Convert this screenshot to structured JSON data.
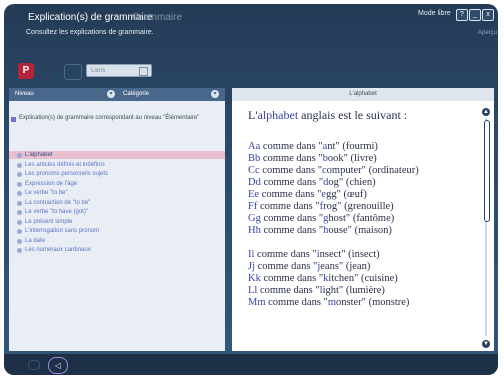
{
  "window": {
    "title": "Explication(s) de grammaire",
    "title_ghost": "Grammaire",
    "subtitle": "Consultez les explications de grammaire.",
    "mode_label": "Mode libre",
    "apercu_label": "Aperçu",
    "controls": [
      "?",
      "_",
      "x"
    ]
  },
  "toolbar": {
    "red_button_label": "P",
    "field_label": "Liens"
  },
  "left_panel": {
    "header": {
      "niveau": "Niveau",
      "categorie": "Catégorie"
    },
    "intro": "Explication(s) de grammaire correspondant au niveau \"Élémentaire\"",
    "items": [
      {
        "label": "L'alphabet",
        "selected": true
      },
      {
        "label": "Les articles définis et indéfinis"
      },
      {
        "label": "Les pronoms personnels sujets"
      },
      {
        "label": "Expression de l'âge"
      },
      {
        "label": "Le verbe \"to be\""
      },
      {
        "label": "La contraction de \"to be\""
      },
      {
        "label": "Le verbe \"to have (got)\""
      },
      {
        "label": "Le présent simple"
      },
      {
        "label": "L'interrogation sans pronom"
      },
      {
        "label": "La date"
      },
      {
        "label": "Les numéraux cardinaux"
      }
    ]
  },
  "right_panel": {
    "header": "L'alphabet",
    "intro_prefix": "L'",
    "intro_word": "alphabet",
    "intro_suffix": " anglais est le suivant :",
    "lines": [
      {
        "label": "Aa",
        "pre": " comme dans \"",
        "hl": "a",
        "rest": "nt\" (fourmi)"
      },
      {
        "label": "Bb",
        "pre": " comme dans \"",
        "hl": "b",
        "rest": "ook\" (livre)"
      },
      {
        "label": "Cc",
        "pre": " comme dans \"",
        "hl": "c",
        "rest": "omputer\" (ordinateur)"
      },
      {
        "label": "Dd",
        "pre": " comme dans \"",
        "hl": "d",
        "rest": "og\" (chien)"
      },
      {
        "label": "Ee",
        "pre": " comme dans \"",
        "hl": "e",
        "rest": "gg\" (œuf)"
      },
      {
        "label": "Ff",
        "pre": " comme dans \"",
        "hl": "f",
        "rest": "rog\" (grenouille)"
      },
      {
        "label": "Gg",
        "pre": " comme dans \"",
        "hl": "g",
        "rest": "host\" (fantôme)"
      },
      {
        "label": "Hh",
        "pre": " comme dans \"",
        "hl": "h",
        "rest": "ouse\" (maison)"
      },
      {
        "label": "Ii",
        "pre": " comme dans \"",
        "hl": "i",
        "rest": "nsect\" (insect)"
      },
      {
        "label": "Jj",
        "pre": " comme dans \"",
        "hl": "j",
        "rest": "eans\" (jean)"
      },
      {
        "label": "Kk",
        "pre": " comme dans \"",
        "hl": "k",
        "rest": "itchen\" (cuisine)"
      },
      {
        "label": "Ll",
        "pre": " comme dans \"",
        "hl": "l",
        "rest": "ight\" (lumière)"
      },
      {
        "label": "Mm",
        "pre": " comme dans \"",
        "hl": "m",
        "rest": "onster\" (monstre)"
      }
    ]
  },
  "bottom_bar": {
    "play_button": "◁"
  },
  "colors": {
    "frame": "#2a4768",
    "accent_text": "#3a45a8",
    "selected_row": "#e7bfcf",
    "red_button": "#b3233a"
  }
}
